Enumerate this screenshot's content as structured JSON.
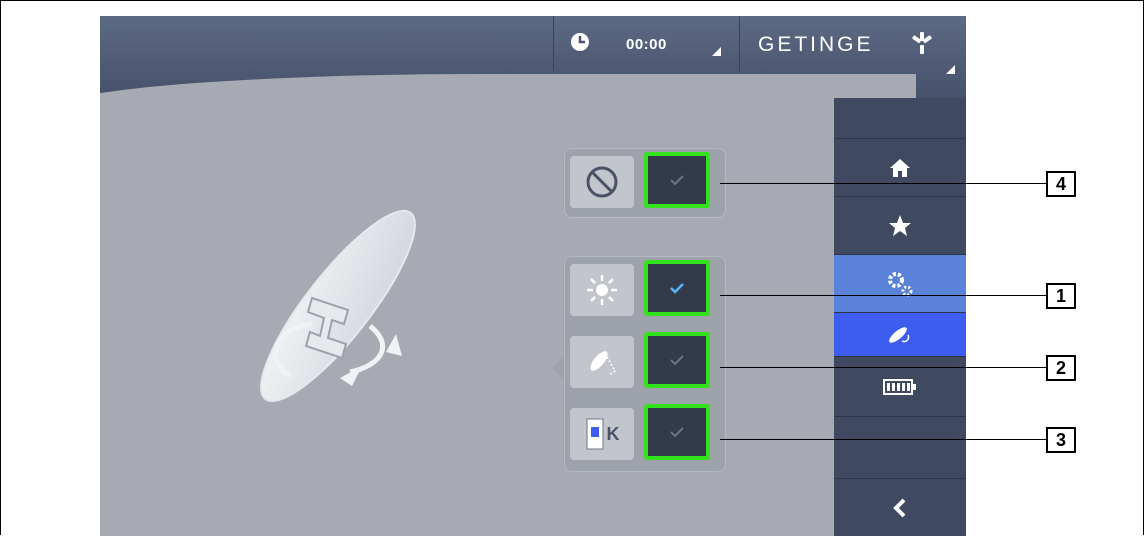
{
  "header": {
    "time": "00:00",
    "brand": "GETINGE"
  },
  "sidebar": {
    "items": [
      {
        "icon": "home-icon"
      },
      {
        "icon": "star-icon"
      },
      {
        "icon": "settings-gears-icon"
      },
      {
        "icon": "light-head-icon"
      },
      {
        "icon": "battery-icon"
      },
      {
        "icon": "back-chevron-icon"
      }
    ]
  },
  "options": {
    "disable": {
      "icon": "prohibited-icon",
      "checked": false
    },
    "brightness": {
      "icon": "sun-icon",
      "checked": true
    },
    "positioning": {
      "icon": "light-positioning-icon",
      "checked": false
    },
    "color_temperature": {
      "icon": "color-temperature-icon",
      "letter": "K",
      "checked": false
    }
  },
  "callouts": [
    "4",
    "1",
    "2",
    "3"
  ],
  "colors": {
    "highlight": "#34e21b",
    "active_check": "#5bb4ff",
    "inactive_check": "#6d7585",
    "sidebar_active": "#5a82d9",
    "sidebar_selected": "#3d5cf0"
  }
}
